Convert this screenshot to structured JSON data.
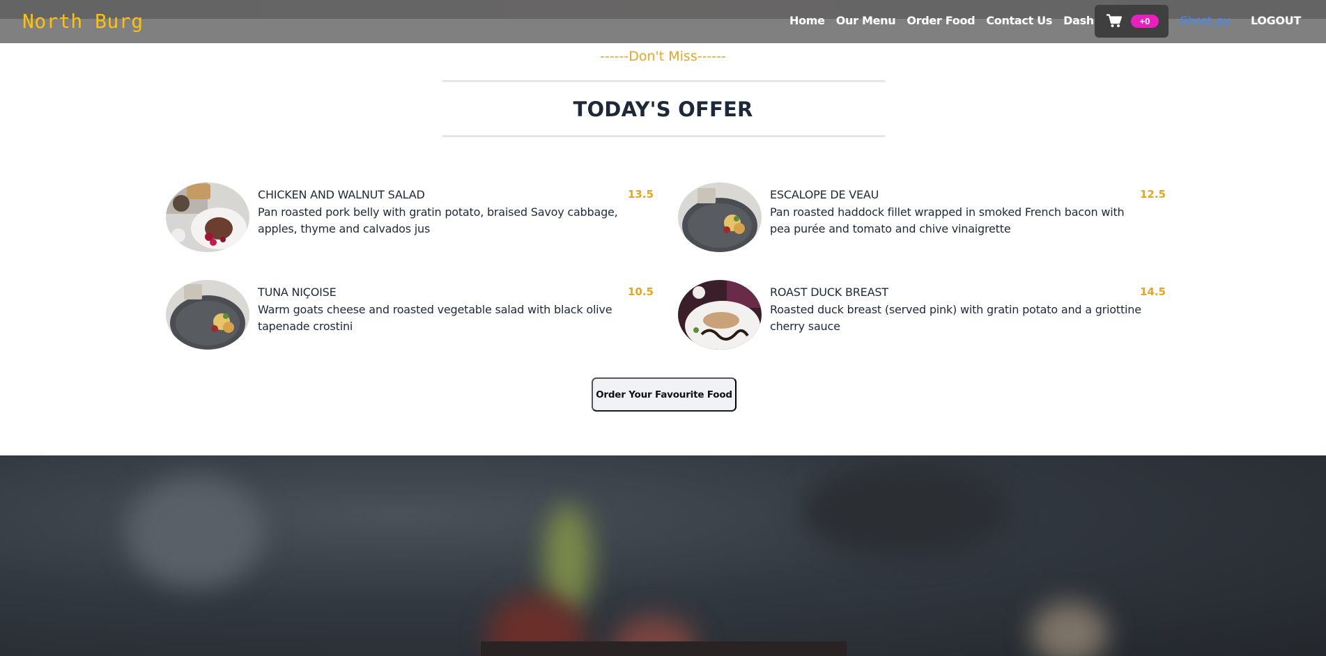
{
  "navbar": {
    "brand": "North Burg",
    "links": [
      "Home",
      "Our Menu",
      "Order Food",
      "Contact Us",
      "Dashboard"
    ],
    "cart_count": "+0",
    "user": "Ghost_py",
    "logout": "LOGOUT"
  },
  "offer": {
    "kicker": "------Don't Miss------",
    "title": "TODAY'S OFFER",
    "items": [
      {
        "name": "CHICKEN AND WALNUT SALAD",
        "price": "13.5",
        "desc": "Pan roasted pork belly with gratin potato, braised Savoy cabbage, apples, thyme and calvados jus"
      },
      {
        "name": "ESCALOPE DE VEAU",
        "price": "12.5",
        "desc": "Pan roasted haddock fillet wrapped in smoked French bacon with pea purée and tomato and chive vinaigrette"
      },
      {
        "name": "TUNA NIÇOISE",
        "price": "10.5",
        "desc": "Warm goats cheese and roasted vegetable salad with black olive tapenade crostini"
      },
      {
        "name": "ROAST DUCK BREAST",
        "price": "14.5",
        "desc": "Roasted duck breast (served pink) with gratin potato and a griottine cherry sauce"
      }
    ],
    "order_button": "Order Your Favourite Food"
  },
  "colors": {
    "brand": "#ffc107",
    "accent": "#e8a522",
    "badge": "#ea1fbf",
    "user_link": "#3d8bfd"
  },
  "icons": [
    "cart-icon"
  ]
}
